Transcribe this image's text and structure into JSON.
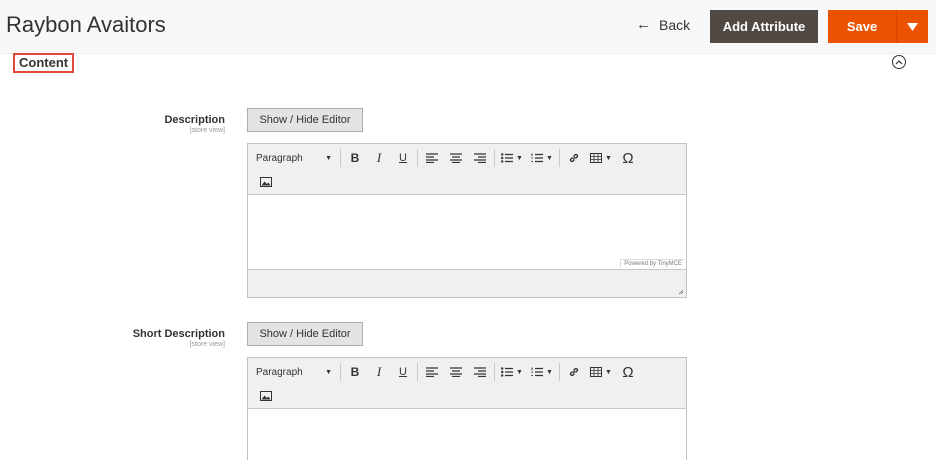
{
  "header": {
    "title": "Raybon Avaitors",
    "back_label": "Back",
    "add_attribute_label": "Add Attribute",
    "save_label": "Save"
  },
  "section": {
    "title": "Content"
  },
  "fields": [
    {
      "label": "Description",
      "scope": "[store view]",
      "toggle_label": "Show / Hide Editor",
      "format_value": "Paragraph",
      "powered_by": "Powered by TinyMCE"
    },
    {
      "label": "Short Description",
      "scope": "[store view]",
      "toggle_label": "Show / Hide Editor",
      "format_value": "Paragraph"
    }
  ],
  "toolbar_icons": [
    "bold-icon",
    "italic-icon",
    "underline-icon",
    "align-left-icon",
    "align-center-icon",
    "align-right-icon",
    "bullet-list-icon",
    "numbered-list-icon",
    "link-icon",
    "table-icon",
    "special-character-icon",
    "image-icon"
  ],
  "toolbar_glyphs": {
    "bold": "B",
    "italic": "I",
    "underline": "U",
    "special_char": "Ω"
  },
  "colors": {
    "accent_save": "#eb5202",
    "add_attribute_bg": "#514943",
    "section_highlight": "#e2483d"
  }
}
